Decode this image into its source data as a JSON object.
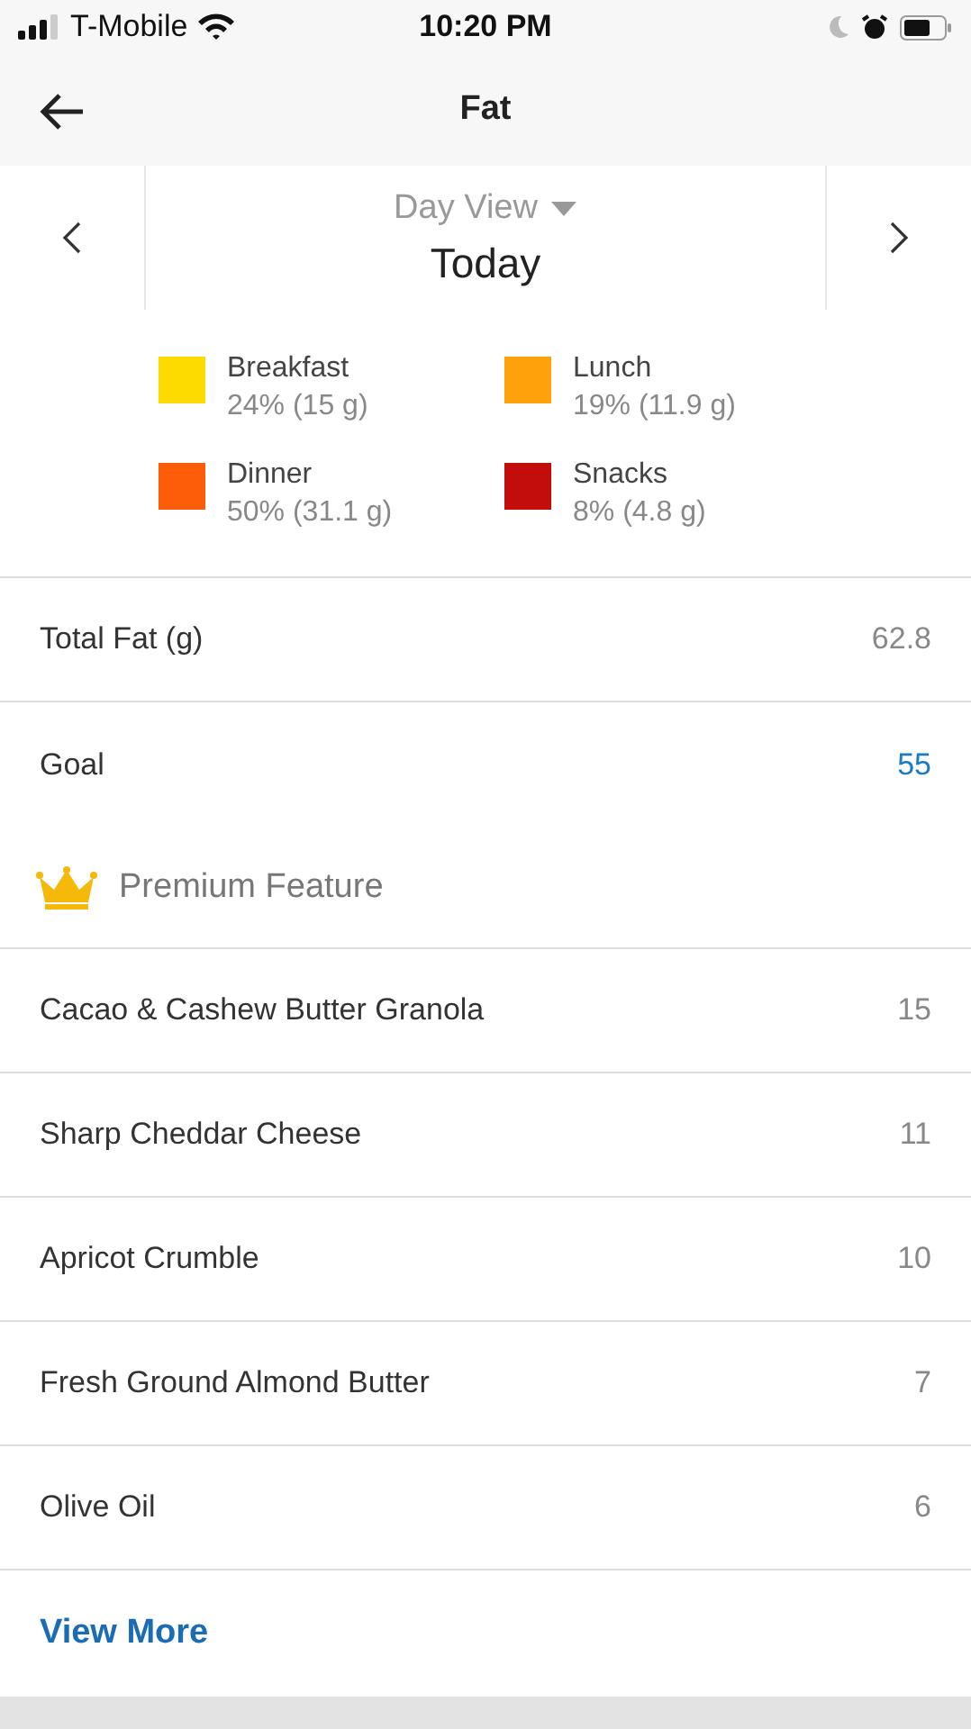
{
  "status_bar": {
    "carrier": "T-Mobile",
    "time": "10:20 PM"
  },
  "header": {
    "title": "Fat"
  },
  "date_nav": {
    "view": "Day View",
    "date": "Today"
  },
  "legend": [
    {
      "name": "Breakfast",
      "value": "24% (15 g)",
      "color": "#fddb00"
    },
    {
      "name": "Lunch",
      "value": "19% (11.9 g)",
      "color": "#fea20b"
    },
    {
      "name": "Dinner",
      "value": "50% (31.1 g)",
      "color": "#fd5c08"
    },
    {
      "name": "Snacks",
      "value": "8% (4.8 g)",
      "color": "#c30d0b"
    }
  ],
  "summary": [
    {
      "label": "Total Fat (g)",
      "value": "62.8",
      "kind": "total"
    },
    {
      "label": "Goal",
      "value": "55",
      "kind": "goal"
    }
  ],
  "premium": {
    "label": "Premium Feature"
  },
  "foods": [
    {
      "name": "Cacao & Cashew Butter Granola",
      "value": "15"
    },
    {
      "name": "Sharp Cheddar Cheese",
      "value": "11"
    },
    {
      "name": "Apricot Crumble",
      "value": "10"
    },
    {
      "name": "Fresh Ground Almond Butter",
      "value": "7"
    },
    {
      "name": "Olive Oil",
      "value": "6"
    }
  ],
  "view_more": "View More"
}
